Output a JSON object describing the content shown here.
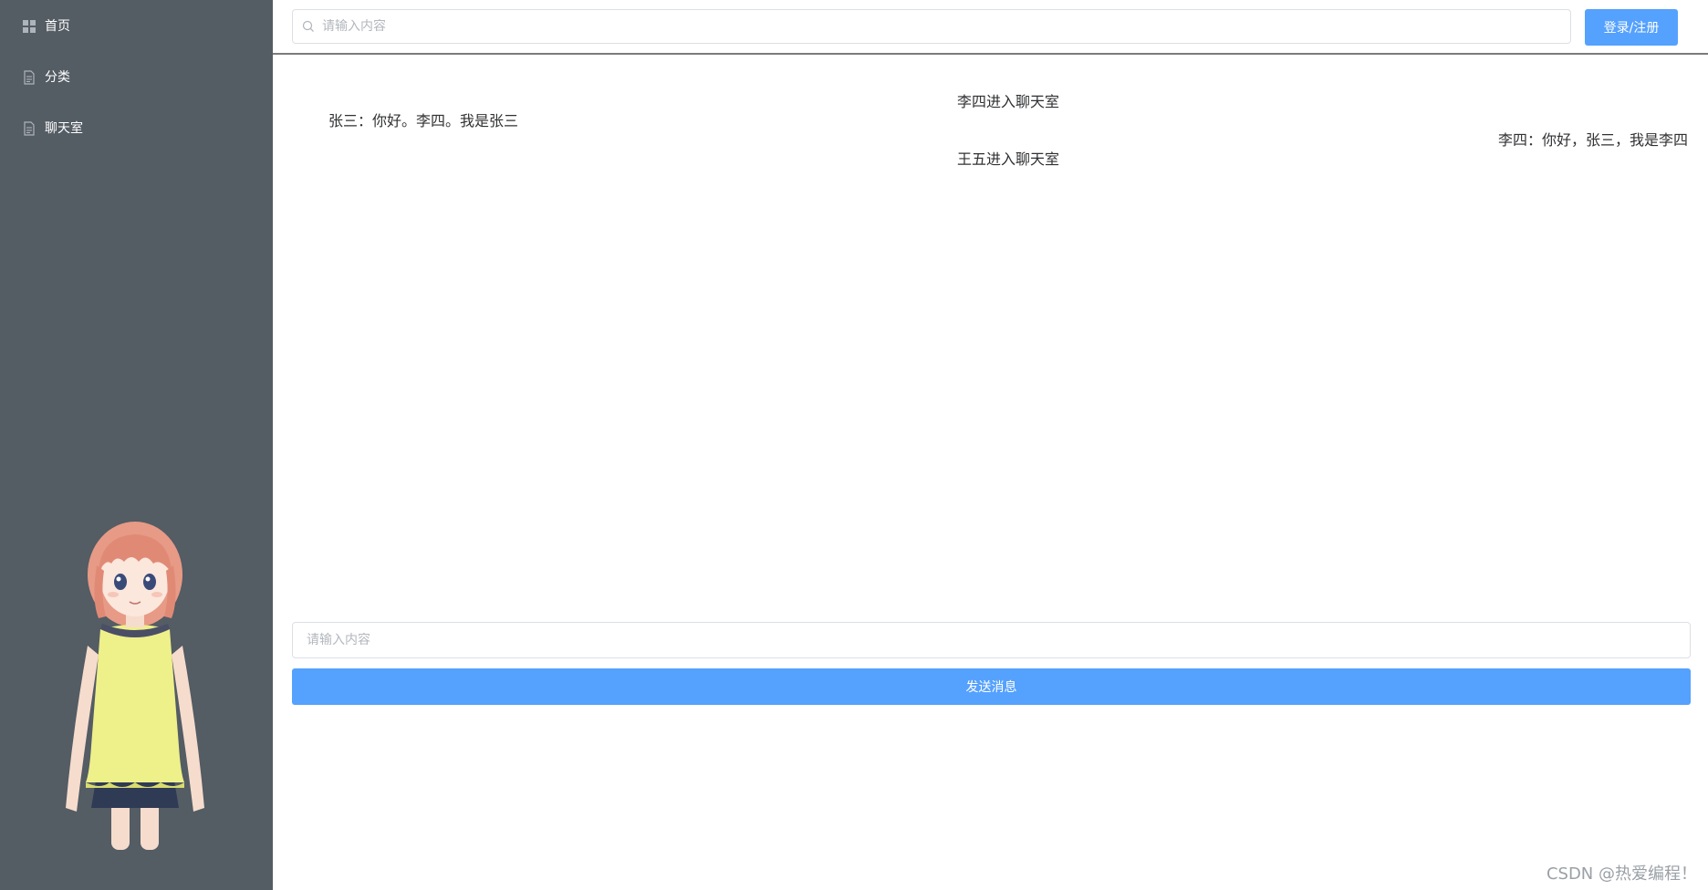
{
  "sidebar": {
    "items": [
      {
        "label": "首页",
        "icon": "grid-icon"
      },
      {
        "label": "分类",
        "icon": "document-icon"
      },
      {
        "label": "聊天室",
        "icon": "document-icon"
      }
    ]
  },
  "header": {
    "search_placeholder": "请输入内容",
    "login_label": "登录/注册"
  },
  "chat": {
    "messages": [
      {
        "type": "system",
        "text": "李四进入聊天室"
      },
      {
        "type": "left",
        "text": "张三：你好。李四。我是张三"
      },
      {
        "type": "right",
        "text": "李四：你好，张三，我是李四"
      },
      {
        "type": "system",
        "text": "王五进入聊天室"
      }
    ]
  },
  "compose": {
    "placeholder": "请输入内容",
    "send_label": "发送消息"
  },
  "watermark": "CSDN @热爱编程！",
  "colors": {
    "sidebar_bg": "#545c64",
    "accent": "#55a1fe"
  }
}
